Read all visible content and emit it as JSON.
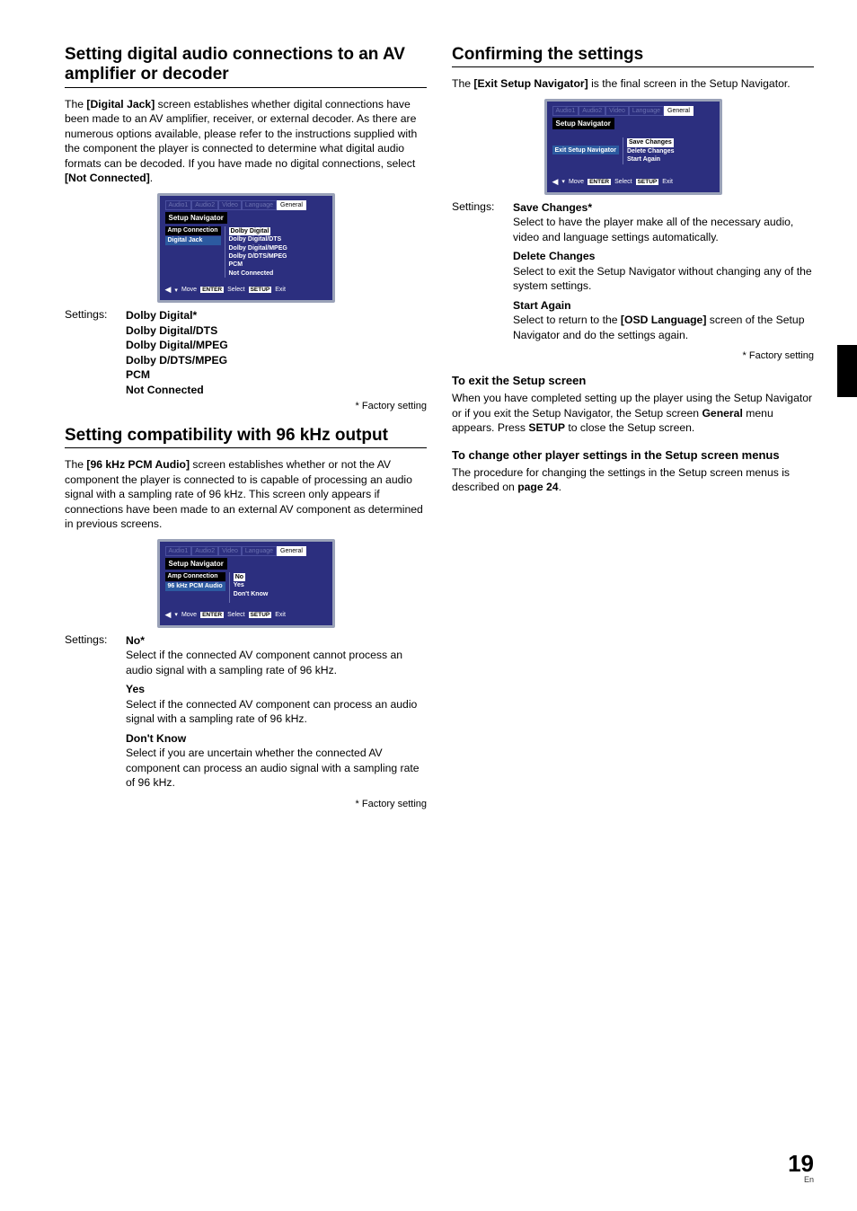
{
  "page": {
    "number": "19",
    "lang": "En"
  },
  "left": {
    "sec1": {
      "title": "Setting digital audio connections to an AV amplifier or decoder",
      "p1a": "The ",
      "p1b": "[Digital Jack]",
      "p1c": " screen establishes whether digital connections have been made to an AV amplifier, receiver, or external decoder. As there are numerous options available, please refer to the instructions supplied with the component the player is connected to determine what digital audio formats can be decoded. If you have made no digital connections, select ",
      "p1d": "[Not Connected]",
      "p1e": ".",
      "osd": {
        "tabs": [
          "Audio1",
          "Audio2",
          "Video",
          "Language",
          "General"
        ],
        "title": "Setup Navigator",
        "leftRows": [
          "Amp Connection",
          "Digital Jack"
        ],
        "rightItems": [
          "Dolby Digital",
          "Dolby Digital/DTS",
          "Dolby Digital/MPEG",
          "Dolby D/DTS/MPEG",
          "PCM",
          "Not Connected"
        ],
        "footer": {
          "arrow": "◀",
          "move": "Move",
          "enter": "ENTER",
          "select": "Select",
          "setup": "SETUP",
          "exit": "Exit"
        }
      },
      "settingsLabel": "Settings:",
      "settings": [
        "Dolby Digital*",
        "Dolby Digital/DTS",
        "Dolby Digital/MPEG",
        "Dolby D/DTS/MPEG",
        "PCM",
        "Not Connected"
      ],
      "note": "* Factory setting"
    },
    "sec2": {
      "title": "Setting compatibility with 96 kHz output",
      "p1a": "The ",
      "p1b": "[96 kHz PCM Audio]",
      "p1c": " screen establishes whether or not the AV component the player is connected to is capable of processing an audio signal with a sampling rate of 96 kHz. This screen only appears if connections have been made to an external AV component as determined in previous screens.",
      "osd": {
        "tabs": [
          "Audio1",
          "Audio2",
          "Video",
          "Language",
          "General"
        ],
        "title": "Setup Navigator",
        "leftRows": [
          "Amp Connection",
          "96 kHz PCM Audio"
        ],
        "rightItems": [
          "No",
          "Yes",
          "Don't Know"
        ],
        "footer": {
          "arrow": "◀",
          "move": "Move",
          "enter": "ENTER",
          "select": "Select",
          "setup": "SETUP",
          "exit": "Exit"
        }
      },
      "settingsLabel": "Settings:",
      "opts": {
        "no": {
          "h": "No*",
          "d": "Select if the connected AV component cannot process an audio signal with a sampling rate of 96 kHz."
        },
        "yes": {
          "h": "Yes",
          "d": "Select if the connected AV component can process an audio signal with a sampling rate of 96 kHz."
        },
        "dk": {
          "h": "Don't Know",
          "d": "Select if you are uncertain whether the connected AV component can process an audio signal with a sampling rate of 96 kHz."
        }
      },
      "note": "* Factory setting"
    }
  },
  "right": {
    "sec1": {
      "title": "Confirming the settings",
      "p1a": "The ",
      "p1b": "[Exit Setup Navigator]",
      "p1c": " is the final screen in the Setup Navigator.",
      "osd": {
        "tabs": [
          "Audio1",
          "Audio2",
          "Video",
          "Language",
          "General"
        ],
        "title": "Setup Navigator",
        "leftRows": [
          "Exit Setup Navigator"
        ],
        "rightItems": [
          "Save Changes",
          "Delete Changes",
          "Start Again"
        ],
        "footer": {
          "arrow": "◀",
          "move": "Move",
          "enter": "ENTER",
          "select": "Select",
          "setup": "SETUP",
          "exit": "Exit"
        }
      },
      "settingsLabel": "Settings:",
      "opts": {
        "save": {
          "h": "Save Changes*",
          "d": "Select to have the player make all of the necessary audio, video and language settings automatically."
        },
        "del": {
          "h": "Delete Changes",
          "d": "Select to exit the Setup Navigator without changing any of the system settings."
        },
        "again": {
          "h": "Start Again",
          "d1": "Select to return to the ",
          "d2": "[OSD Language]",
          "d3": " screen of the Setup Navigator and do the settings again."
        }
      },
      "note": "* Factory setting"
    },
    "sec2": {
      "h": "To exit the Setup screen",
      "p1": "When you have completed setting up the player using the Setup Navigator or if you exit the Setup Navigator, the Setup screen ",
      "p1b": "General",
      "p1c": " menu appears. Press ",
      "p1d": "SETUP",
      "p1e": " to close the Setup screen."
    },
    "sec3": {
      "h": "To change other player settings in the Setup screen menus",
      "p1": "The procedure for changing the settings in the Setup screen menus is described on ",
      "p1b": "page 24",
      "p1c": "."
    }
  }
}
